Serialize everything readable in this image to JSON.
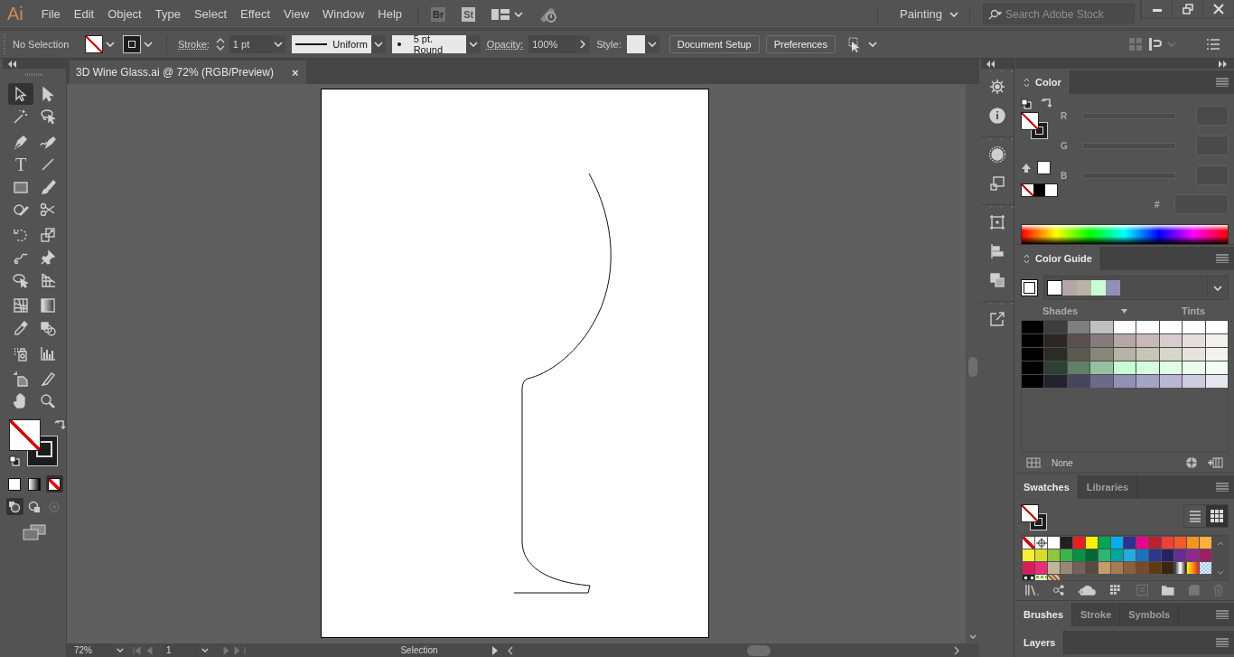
{
  "menubar": {
    "logo": "Ai",
    "menus": [
      "File",
      "Edit",
      "Object",
      "Type",
      "Select",
      "Effect",
      "View",
      "Window",
      "Help"
    ],
    "bridge": "Br",
    "stock": "St",
    "workspace": "Painting",
    "search": {
      "placeholder": "Search Adobe Stock"
    }
  },
  "control_bar": {
    "selection": "No Selection",
    "stroke_label": "Stroke:",
    "stroke_weight": "1 pt",
    "profile": "Uniform",
    "brush": "5 pt. Round",
    "opacity_label": "Opacity:",
    "opacity": "100%",
    "style_label": "Style:",
    "buttons": [
      "Document Setup",
      "Preferences"
    ]
  },
  "tools": [
    {
      "kind": "selection",
      "selected": true
    },
    {
      "kind": "direct",
      "selected": false
    },
    {
      "kind": "wand",
      "selected": false
    },
    {
      "kind": "lasso",
      "selected": false
    },
    {
      "kind": "pen",
      "selected": false
    },
    {
      "kind": "curvature",
      "selected": false
    },
    {
      "kind": "type",
      "glyph": "T",
      "selected": false
    },
    {
      "kind": "line",
      "selected": false
    },
    {
      "kind": "rectangle",
      "selected": false
    },
    {
      "kind": "brush",
      "selected": false
    },
    {
      "kind": "shaper",
      "selected": false
    },
    {
      "kind": "scissors",
      "selected": false
    },
    {
      "kind": "rotate",
      "selected": false
    },
    {
      "kind": "scale",
      "selected": false
    },
    {
      "kind": "warp",
      "selected": false
    },
    {
      "kind": "pin",
      "selected": false
    },
    {
      "kind": "builder",
      "selected": false
    },
    {
      "kind": "perspective",
      "selected": false
    },
    {
      "kind": "mesh",
      "selected": false
    },
    {
      "kind": "gradient",
      "selected": false
    },
    {
      "kind": "eyedropper",
      "selected": false
    },
    {
      "kind": "blend",
      "selected": false
    },
    {
      "kind": "sprayer",
      "selected": false
    },
    {
      "kind": "graph",
      "selected": false
    },
    {
      "kind": "artboard",
      "selected": false
    },
    {
      "kind": "slice",
      "selected": false
    },
    {
      "kind": "hand",
      "selected": false
    },
    {
      "kind": "zoom",
      "selected": false
    }
  ],
  "color_modes": [
    {
      "kind": "color",
      "selected": false
    },
    {
      "kind": "gradient",
      "selected": false
    },
    {
      "kind": "none",
      "selected": true
    }
  ],
  "draw_modes": [
    {
      "kind": "normal",
      "selected": true,
      "disabled": false
    },
    {
      "kind": "behind",
      "selected": false,
      "disabled": false
    },
    {
      "kind": "inside",
      "selected": false,
      "disabled": true
    }
  ],
  "document_tab": {
    "title": "3D Wine Glass.ai @ 72% (RGB/Preview)",
    "close": "×"
  },
  "status_bar": {
    "zoom": "72%",
    "artboard": "1",
    "tool": "Selection"
  },
  "color_panel": {
    "tab": "Color",
    "channels": [
      {
        "label": "R"
      },
      {
        "label": "G"
      },
      {
        "label": "B"
      }
    ],
    "hex_label": "#"
  },
  "color_guide": {
    "tab": "Color Guide",
    "harmony": [
      {
        "color": "#ffffff"
      },
      {
        "color": "#b5a7a7"
      },
      {
        "color": "#b5b5a5"
      },
      {
        "color": "#c9fdd3"
      },
      {
        "color": "#9090b7"
      }
    ],
    "shades": "Shades",
    "tints": "Tints",
    "grid": [
      {
        "color": "#000000"
      },
      {
        "color": "#3d3d3d"
      },
      {
        "color": "#7f7f7f"
      },
      {
        "color": "#c0c0c0"
      },
      {
        "color": "#ffffff"
      },
      {
        "color": "#ffffff"
      },
      {
        "color": "#ffffff"
      },
      {
        "color": "#ffffff"
      },
      {
        "color": "#ffffff"
      },
      {
        "color": "#000000"
      },
      {
        "color": "#2d2626"
      },
      {
        "color": "#5b5050"
      },
      {
        "color": "#877a7a"
      },
      {
        "color": "#b5a7a7"
      },
      {
        "color": "#c8b8b8"
      },
      {
        "color": "#d8cccc"
      },
      {
        "color": "#e6dede"
      },
      {
        "color": "#f3efef"
      },
      {
        "color": "#000000"
      },
      {
        "color": "#2c2c27"
      },
      {
        "color": "#5a5a50"
      },
      {
        "color": "#878779"
      },
      {
        "color": "#b5b5a5"
      },
      {
        "color": "#c6c6b8"
      },
      {
        "color": "#d6d6cb"
      },
      {
        "color": "#e4e4dc"
      },
      {
        "color": "#f2f2ee"
      },
      {
        "color": "#000000"
      },
      {
        "color": "#2c4034"
      },
      {
        "color": "#617f68"
      },
      {
        "color": "#96c09f"
      },
      {
        "color": "#c9fdd3"
      },
      {
        "color": "#d5fddc"
      },
      {
        "color": "#e1fde6"
      },
      {
        "color": "#ebfdef"
      },
      {
        "color": "#f4fef7"
      },
      {
        "color": "#000000"
      },
      {
        "color": "#23232e"
      },
      {
        "color": "#45455c"
      },
      {
        "color": "#6a6a8a"
      },
      {
        "color": "#9090b7"
      },
      {
        "color": "#a4a4c6"
      },
      {
        "color": "#b8b8d3"
      },
      {
        "color": "#cdcde0"
      },
      {
        "color": "#e6e6ee"
      }
    ],
    "swatch_name": "None"
  },
  "swatches_panel": {
    "tabs": [
      {
        "label": "Swatches",
        "selected": true
      },
      {
        "label": "Libraries",
        "selected": false
      }
    ],
    "views": [
      {
        "kind": "list",
        "selected": false
      },
      {
        "kind": "grid",
        "selected": true
      }
    ],
    "swatches": [
      {
        "kind": "none"
      },
      {
        "kind": "registration"
      },
      {
        "kind": "color",
        "color": "#ffffff"
      },
      {
        "kind": "color",
        "color": "#231f20"
      },
      {
        "kind": "color",
        "color": "#ed1c24"
      },
      {
        "kind": "color",
        "color": "#fff200"
      },
      {
        "kind": "color",
        "color": "#00a651"
      },
      {
        "kind": "color",
        "color": "#00aeef"
      },
      {
        "kind": "color",
        "color": "#2e3192"
      },
      {
        "kind": "color",
        "color": "#ec008c"
      },
      {
        "kind": "color",
        "color": "#be1e2d"
      },
      {
        "kind": "color",
        "color": "#ef4136"
      },
      {
        "kind": "color",
        "color": "#f15a29"
      },
      {
        "kind": "color",
        "color": "#f7941d"
      },
      {
        "kind": "color",
        "color": "#fbb040"
      },
      {
        "kind": "color",
        "color": "#f9ed32"
      },
      {
        "kind": "color",
        "color": "#d7df23"
      },
      {
        "kind": "color",
        "color": "#8dc63f"
      },
      {
        "kind": "color",
        "color": "#39b54a"
      },
      {
        "kind": "color",
        "color": "#009444"
      },
      {
        "kind": "color",
        "color": "#006838"
      },
      {
        "kind": "color",
        "color": "#2bb673"
      },
      {
        "kind": "color",
        "color": "#00a79d"
      },
      {
        "kind": "color",
        "color": "#27aae1"
      },
      {
        "kind": "color",
        "color": "#1c75bc"
      },
      {
        "kind": "color",
        "color": "#2b388f"
      },
      {
        "kind": "color",
        "color": "#262262"
      },
      {
        "kind": "color",
        "color": "#662d91"
      },
      {
        "kind": "color",
        "color": "#92278f"
      },
      {
        "kind": "color",
        "color": "#9e1f63"
      },
      {
        "kind": "color",
        "color": "#da1c5c"
      },
      {
        "kind": "color",
        "color": "#ee2a7b"
      },
      {
        "kind": "color",
        "color": "#c2b59b"
      },
      {
        "kind": "color",
        "color": "#998675"
      },
      {
        "kind": "color",
        "color": "#736357"
      },
      {
        "kind": "color",
        "color": "#594a42"
      },
      {
        "kind": "color",
        "color": "#c69c6d"
      },
      {
        "kind": "color",
        "color": "#a97c50"
      },
      {
        "kind": "color",
        "color": "#8b5e3c"
      },
      {
        "kind": "color",
        "color": "#754c29"
      },
      {
        "kind": "color",
        "color": "#603913"
      },
      {
        "kind": "color",
        "color": "#3c2415"
      },
      {
        "kind": "gradientgray"
      },
      {
        "kind": "gradientorange"
      },
      {
        "kind": "gradientclear"
      },
      {
        "kind": "patterndots"
      },
      {
        "kind": "patterngreen"
      },
      {
        "kind": "patternbrown"
      }
    ]
  },
  "brushes_group": {
    "tabs": [
      {
        "label": "Brushes",
        "selected": true
      },
      {
        "label": "Stroke",
        "selected": false
      },
      {
        "label": "Symbols",
        "selected": false
      }
    ]
  },
  "layers_panel": {
    "tabs": [
      {
        "label": "Layers",
        "selected": true
      }
    ]
  }
}
